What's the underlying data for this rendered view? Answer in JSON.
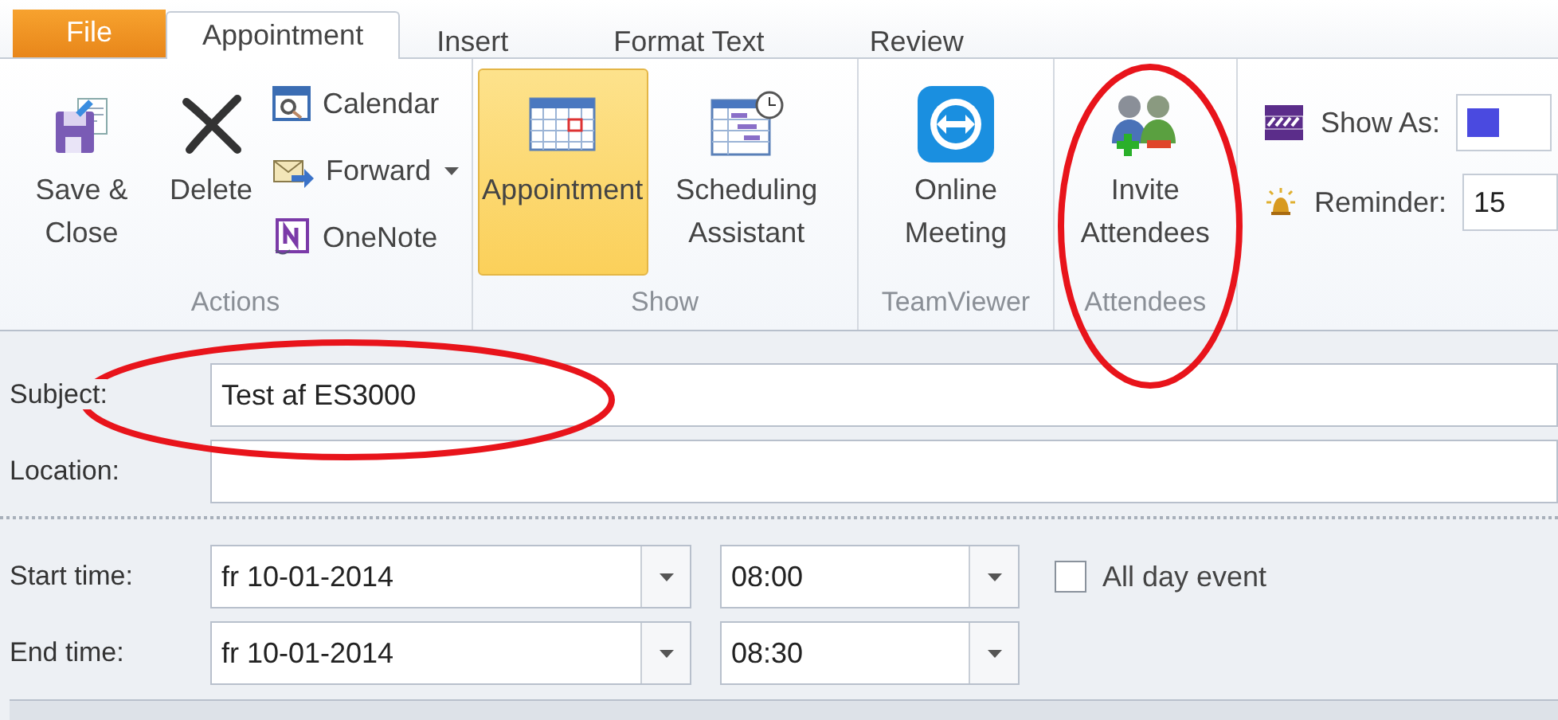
{
  "tabs": [
    {
      "label": "File",
      "kind": "file",
      "selected": false
    },
    {
      "label": "Appointment",
      "kind": "tab",
      "selected": true
    },
    {
      "label": "Insert",
      "kind": "tab",
      "selected": false
    },
    {
      "label": "Format Text",
      "kind": "tab",
      "selected": false
    },
    {
      "label": "Review",
      "kind": "tab",
      "selected": false
    }
  ],
  "ribbon": {
    "groups": [
      {
        "label": "Actions",
        "buttons": [
          {
            "label": "Save & Close",
            "kind": "large",
            "selected": false
          },
          {
            "label": "Delete",
            "kind": "large",
            "selected": false
          },
          {
            "label": "Calendar",
            "kind": "small",
            "selected": false
          },
          {
            "label": "Forward",
            "kind": "small",
            "dropdown": true,
            "selected": false
          },
          {
            "label": "OneNote",
            "kind": "small",
            "selected": false
          }
        ]
      },
      {
        "label": "Show",
        "buttons": [
          {
            "label": "Appointment",
            "kind": "large",
            "selected": true
          },
          {
            "label": "Scheduling Assistant",
            "kind": "large",
            "selected": false
          }
        ]
      },
      {
        "label": "TeamViewer",
        "buttons": [
          {
            "label": "Online Meeting",
            "kind": "large",
            "selected": false
          }
        ]
      },
      {
        "label": "Attendees",
        "buttons": [
          {
            "label": "Invite Attendees",
            "kind": "large",
            "selected": false
          }
        ]
      }
    ],
    "options": [
      {
        "label": "Show As:",
        "kind": "swatch"
      },
      {
        "label": "Reminder:",
        "kind": "text",
        "value": "15"
      }
    ]
  },
  "form": {
    "subject": {
      "label": "Subject:",
      "value": "Test af ES3000"
    },
    "location": {
      "label": "Location:"
    },
    "times": [
      {
        "label": "Start time:",
        "date": "fr 10-01-2014",
        "time": "08:00"
      },
      {
        "label": "End time:",
        "date": "fr 10-01-2014",
        "time": "08:30"
      }
    ],
    "all_day": {
      "label": "All day event",
      "checked": false
    }
  },
  "annotations": [
    {
      "kind": "ellipse",
      "color": "#e8141b"
    },
    {
      "kind": "ellipse",
      "color": "#e8141b"
    }
  ]
}
